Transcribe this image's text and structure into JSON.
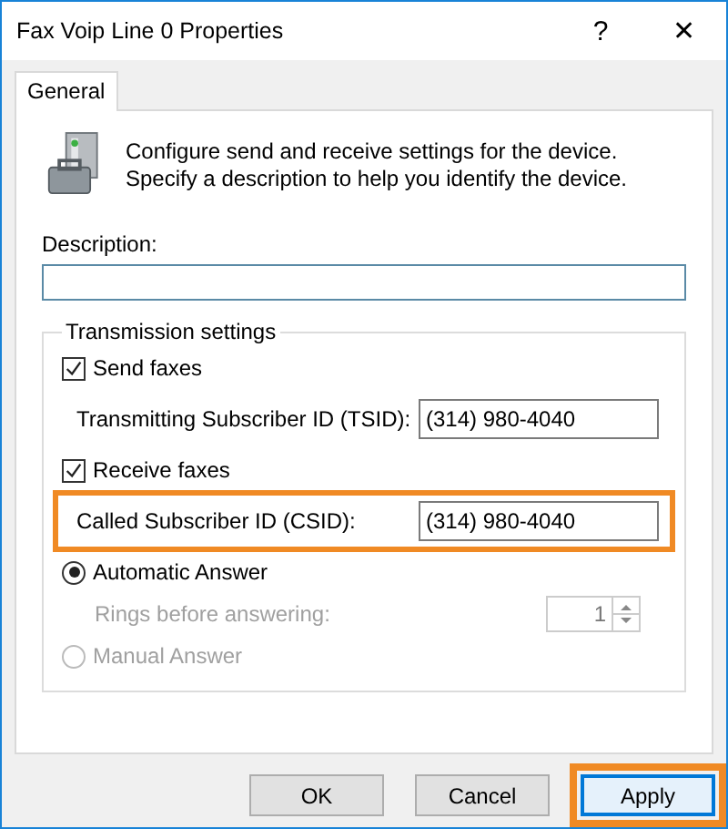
{
  "window": {
    "title": "Fax Voip Line 0 Properties",
    "help": "?",
    "close": "✕"
  },
  "tabs": [
    {
      "label": "General",
      "selected": true
    }
  ],
  "intro": [
    "Configure send and receive settings for the device.",
    "Specify a description to help you identify the device."
  ],
  "description": {
    "label": "Description:"
  },
  "transmission": {
    "title": "Transmission settings",
    "send": {
      "label": "Send faxes",
      "checked": true
    },
    "tsid": {
      "label": "Transmitting Subscriber ID (TSID):",
      "value": "(314) 980-4040",
      "highlighted": false
    },
    "receive": {
      "label": "Receive faxes",
      "checked": true
    },
    "csid": {
      "label": "Called Subscriber ID (CSID):",
      "value": "(314) 980-4040",
      "highlighted": true
    },
    "answer_modes": [
      {
        "label": "Automatic Answer",
        "selected": true,
        "disabled": false
      },
      {
        "label": "Manual Answer",
        "selected": false,
        "disabled": true
      }
    ],
    "rings": {
      "label": "Rings before answering:",
      "value": "1",
      "disabled": true
    }
  },
  "buttons": [
    {
      "label": "OK",
      "highlighted": false
    },
    {
      "label": "Cancel",
      "highlighted": false
    },
    {
      "label": "Apply",
      "highlighted": true
    }
  ]
}
